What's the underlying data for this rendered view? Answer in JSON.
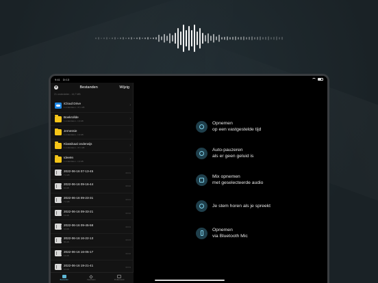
{
  "status": {
    "time": "9:41",
    "date": "Di 13"
  },
  "sidebar": {
    "title": "Bestanden",
    "edit_label": "Wijzig",
    "summary": "21 onderdelen - 16,7 MB",
    "items": [
      {
        "name": "iCloud Drive",
        "sub": "1 onderdelen - 37,1 kB",
        "icon": "cloud-icon",
        "meta": "",
        "chevron": true
      },
      {
        "name": "Boekrollde",
        "sub": "1 onderdelen - 1,9 kB",
        "icon": "folder-icon",
        "meta": "",
        "chevron": true
      },
      {
        "name": "Jemessie",
        "sub": "1 onderdelen - 1,9 kB",
        "icon": "folder-icon",
        "meta": "",
        "chevron": true
      },
      {
        "name": "Klassikaal onderwijs",
        "sub": "1 onderdelen - 37,1 kB",
        "icon": "folder-icon",
        "meta": "",
        "chevron": true
      },
      {
        "name": "Ideeën",
        "sub": "1 onderdelen - 1,9 kB",
        "icon": "folder-icon",
        "meta": "",
        "chevron": true
      },
      {
        "name": "2022-06-16 07-13-45",
        "sub": "7,4 kB",
        "icon": "audio-file-icon",
        "meta": "00:01",
        "chevron": false
      },
      {
        "name": "2022-06-16 09-16-44",
        "sub": "10 kB",
        "icon": "audio-file-icon",
        "meta": "00:02",
        "chevron": false
      },
      {
        "name": "2022-06-16 09-23-31",
        "sub": "7,4 kB",
        "icon": "audio-file-icon",
        "meta": "00:01",
        "chevron": false
      },
      {
        "name": "2022-06-16 09-33-21",
        "sub": "13 kB",
        "icon": "audio-file-icon",
        "meta": "00:02",
        "chevron": false
      },
      {
        "name": "2022-06-16 09-45-58",
        "sub": "10 kB",
        "icon": "audio-file-icon",
        "meta": "00:01",
        "chevron": false
      },
      {
        "name": "2022-06-16 16-22-13",
        "sub": "56 kB",
        "icon": "audio-file-icon",
        "meta": "00:03",
        "chevron": false
      },
      {
        "name": "2022-06-16 16-05-17",
        "sub": "13 kB",
        "icon": "audio-file-icon",
        "meta": "00:02",
        "chevron": false
      },
      {
        "name": "2022-06-16 19-21-41",
        "sub": "10 kB",
        "icon": "audio-file-icon",
        "meta": "00:01",
        "chevron": false
      }
    ]
  },
  "tabbar": {
    "tabs": [
      {
        "label": "Bestanden",
        "icon": "folder-icon",
        "active": true
      },
      {
        "label": "Favorieten",
        "icon": "star-icon",
        "active": false
      },
      {
        "label": "Prullenmand",
        "icon": "trash-icon",
        "active": false
      }
    ]
  },
  "features": [
    {
      "line1": "Opnemen",
      "line2": "op een vastgestelde tijd",
      "icon": "timer-icon"
    },
    {
      "line1": "Auto-pauzeren",
      "line2": "als er geen geluid is",
      "icon": "speaker-icon"
    },
    {
      "line1": "Mix opnemen",
      "line2": "met geselecteerde audio",
      "icon": "mix-icon"
    },
    {
      "line1": "Je stem horen als je spreekt",
      "line2": "",
      "icon": "ear-icon"
    },
    {
      "line1": "Opnemen",
      "line2": "via Bluetooth Mic",
      "icon": "bluetooth-icon"
    }
  ],
  "colors": {
    "accent": "#5fb8d6",
    "folder": "#f5c518",
    "icloud": "#1e88e5"
  }
}
